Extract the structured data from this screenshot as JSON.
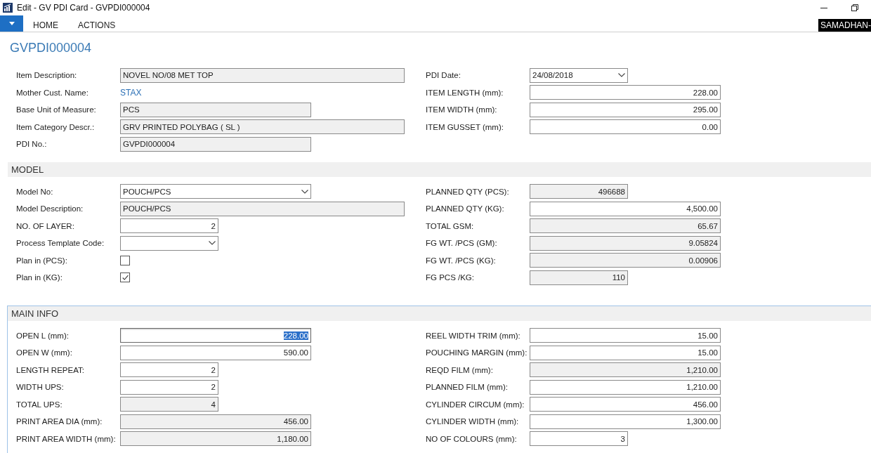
{
  "window": {
    "title": "Edit - GV PDI Card - GVPDI000004"
  },
  "ribbon": {
    "tabs": [
      {
        "label": "HOME",
        "selected": false
      },
      {
        "label": "ACTIONS",
        "selected": false
      }
    ],
    "user": "SAMADHAN-"
  },
  "page_title": "GVPDI000004",
  "sections": [
    {
      "focused": false,
      "columns": [
        [
          {
            "label": "Item Description:",
            "kind": "text",
            "value": "NOVEL NO/08 MET TOP",
            "readonly": true
          },
          {
            "label": "Mother Cust. Name:",
            "kind": "link",
            "value": "STAX"
          },
          {
            "label": "Base Unit of Measure:",
            "kind": "text",
            "value": "PCS",
            "readonly": true
          },
          {
            "label": "Item Category Descr.:",
            "kind": "text",
            "value": "GRV PRINTED POLYBAG ( SL )",
            "readonly": true
          },
          {
            "label": "PDI No.:",
            "kind": "text",
            "value": "GVPDI000004",
            "readonly": true
          }
        ],
        [
          {
            "label": "PDI Date:",
            "kind": "dropdown",
            "value": "24/08/2018",
            "readonly": false
          },
          {
            "label": "ITEM LENGTH (mm):",
            "kind": "number",
            "value": "228.00",
            "readonly": false
          },
          {
            "label": "ITEM WIDTH (mm):",
            "kind": "number",
            "value": "295.00",
            "readonly": false
          },
          {
            "label": "ITEM GUSSET (mm):",
            "kind": "number",
            "value": "0.00",
            "readonly": false
          }
        ]
      ]
    },
    {
      "title": "MODEL",
      "focused": false,
      "columns": [
        [
          {
            "label": "Model No:",
            "kind": "dropdown",
            "value": "POUCH/PCS",
            "readonly": false
          },
          {
            "label": "Model Description:",
            "kind": "text",
            "value": "POUCH/PCS",
            "readonly": true
          },
          {
            "label": "NO. OF LAYER:",
            "kind": "number",
            "value": "2",
            "readonly": false
          },
          {
            "label": "Process Template Code:",
            "kind": "dropdown",
            "readonly": false
          },
          {
            "label": "Plan in (PCS):",
            "kind": "checkbox",
            "checked": false
          },
          {
            "label": "Plan in (KG):",
            "kind": "checkbox",
            "checked": true
          }
        ],
        [
          {
            "label": "PLANNED QTY (PCS):",
            "kind": "number",
            "value": "496688",
            "readonly": true
          },
          {
            "label": "PLANNED QTY (KG):",
            "kind": "number",
            "value": "4,500.00",
            "readonly": false
          },
          {
            "label": "TOTAL GSM:",
            "kind": "number",
            "value": "65.67",
            "readonly": true
          },
          {
            "label": "FG WT. /PCS (GM):",
            "kind": "number",
            "value": "9.05824",
            "readonly": true
          },
          {
            "label": "FG WT. /PCS (KG):",
            "kind": "number",
            "value": "0.00906",
            "readonly": true
          },
          {
            "label": "FG PCS /KG:",
            "kind": "number",
            "value": "110",
            "readonly": true
          }
        ]
      ]
    },
    {
      "title": "MAIN INFO",
      "focused": true,
      "columns": [
        [
          {
            "label": "OPEN L (mm):",
            "kind": "number",
            "value": "228.00",
            "readonly": false,
            "focused": true
          },
          {
            "label": "OPEN W (mm):",
            "kind": "number",
            "value": "590.00",
            "readonly": false
          },
          {
            "label": "LENGTH REPEAT:",
            "kind": "number",
            "value": "2",
            "readonly": false
          },
          {
            "label": "WIDTH UPS:",
            "kind": "number",
            "value": "2",
            "readonly": false
          },
          {
            "label": "TOTAL UPS:",
            "kind": "number",
            "value": "4",
            "readonly": true
          },
          {
            "label": "PRINT AREA DIA (mm):",
            "kind": "number",
            "value": "456.00",
            "readonly": true
          },
          {
            "label": "PRINT AREA WIDTH (mm):",
            "kind": "number",
            "value": "1,180.00",
            "readonly": true
          }
        ],
        [
          {
            "label": "REEL WIDTH TRIM (mm):",
            "kind": "number",
            "value": "15.00",
            "readonly": false
          },
          {
            "label": "POUCHING MARGIN (mm):",
            "kind": "number",
            "value": "15.00",
            "readonly": false
          },
          {
            "label": "REQD FILM (mm):",
            "kind": "number",
            "value": "1,210.00",
            "readonly": true
          },
          {
            "label": "PLANNED FILM (mm):",
            "kind": "number",
            "value": "1,210.00",
            "readonly": false
          },
          {
            "label": "CYLINDER CIRCUM (mm):",
            "kind": "number",
            "value": "456.00",
            "readonly": false
          },
          {
            "label": "CYLINDER WIDTH (mm):",
            "kind": "number",
            "value": "1,300.00",
            "readonly": false
          },
          {
            "label": "NO OF COLOURS (mm):",
            "kind": "number",
            "value": "3",
            "readonly": false
          }
        ]
      ]
    }
  ]
}
